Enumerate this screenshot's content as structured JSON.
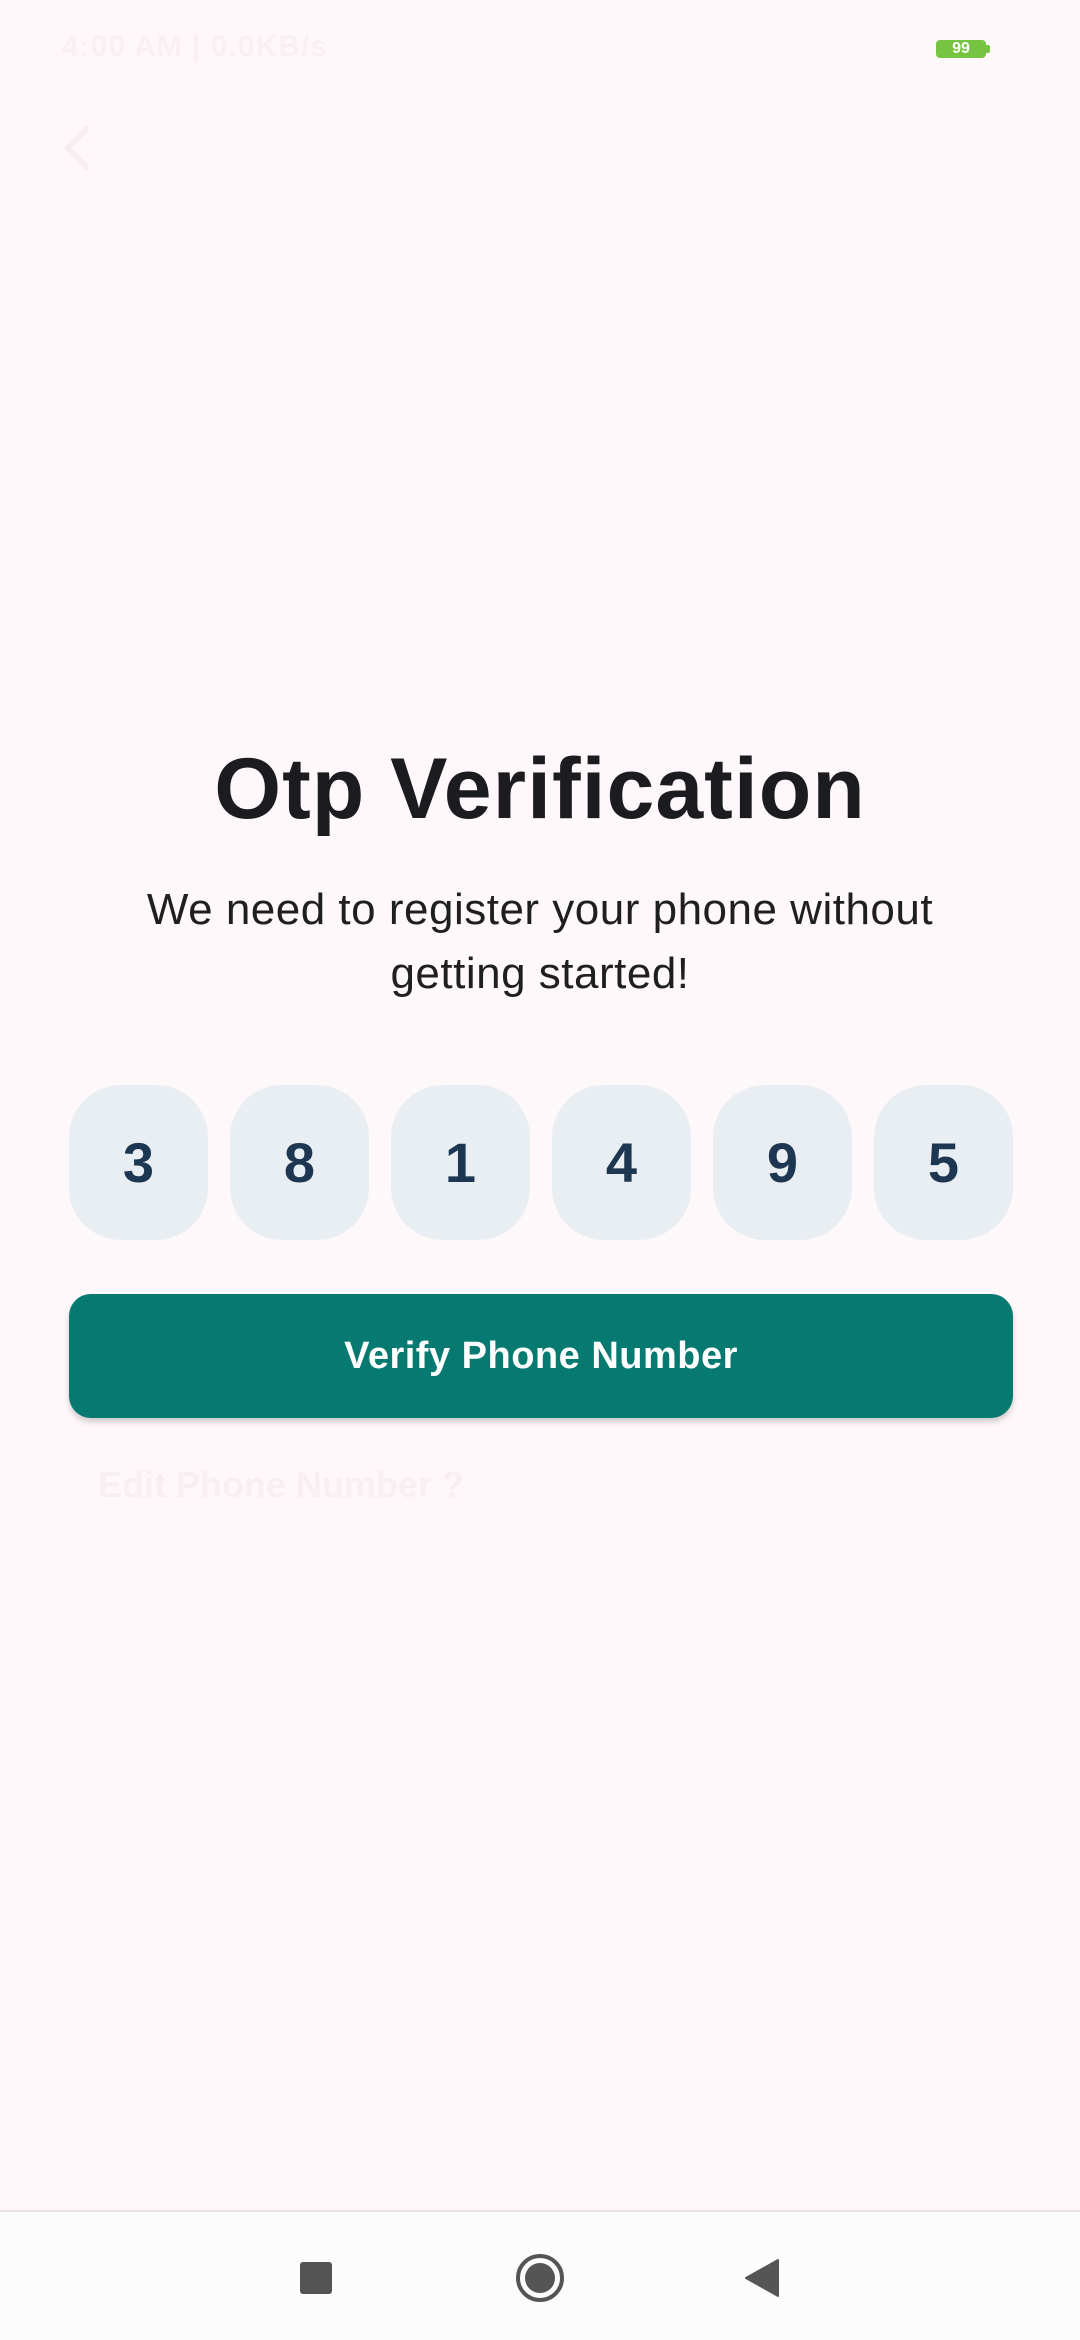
{
  "status_bar": {
    "time_text": "4:00 AM | 0.0KB/s",
    "battery_level": "99",
    "battery_color": "#76c442"
  },
  "app_bar": {
    "back_icon": "arrow-back-icon"
  },
  "main": {
    "title": "Otp Verification",
    "subtitle": "We need to register your phone without getting started!",
    "otp_digits": [
      "3",
      "8",
      "1",
      "4",
      "9",
      "5"
    ],
    "verify_button_label": "Verify Phone Number",
    "edit_phone_label": "Edit Phone Number ?"
  },
  "colors": {
    "accent": "#067a70",
    "otp_box_bg": "#e9eef2",
    "otp_digit": "#1d3651",
    "background": "#fef8fb"
  },
  "nav_bar": {
    "recents_icon": "square-icon",
    "home_icon": "circle-icon",
    "back_icon": "triangle-back-icon"
  }
}
